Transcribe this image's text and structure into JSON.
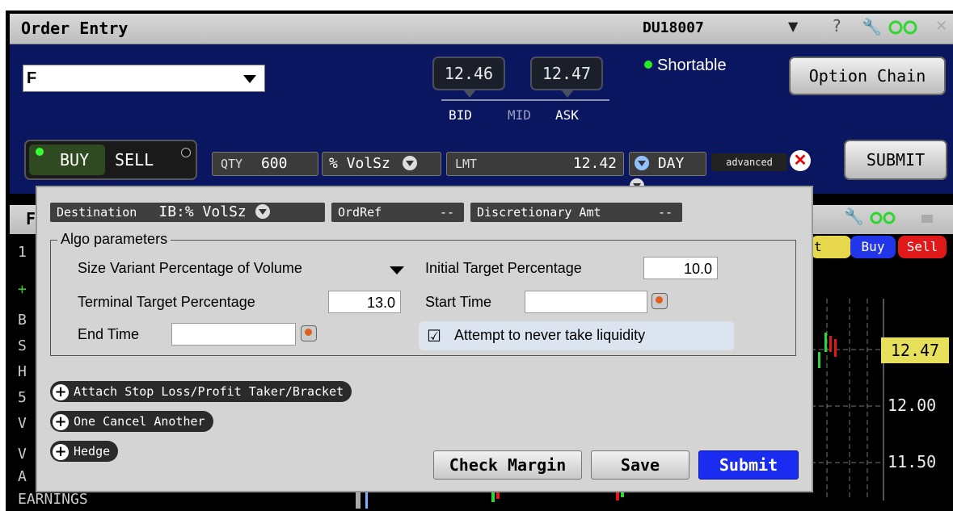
{
  "window": {
    "title": "Order Entry",
    "account": "DU18007",
    "help": "?"
  },
  "order": {
    "symbol": "F",
    "bid": "12.46",
    "ask": "12.47",
    "bid_label": "BID",
    "mid_label": "MID",
    "ask_label": "ASK",
    "shortable": "Shortable",
    "option_chain": "Option Chain",
    "buy": "BUY",
    "sell": "SELL",
    "qty_label": "QTY",
    "qty": "600",
    "order_type": "% VolSz",
    "lmt_label": "LMT",
    "lmt": "12.42",
    "tif": "DAY",
    "advanced": "advanced",
    "submit": "SUBMIT"
  },
  "background_window": {
    "title_initial": "F",
    "left_labels": [
      "1",
      "+",
      "B",
      "S",
      "H",
      "5",
      "V",
      "V",
      "A"
    ],
    "earnings": "EARNINGS",
    "t_btn": "t",
    "buy": "Buy",
    "sell": "Sell",
    "price_tag": "12.47",
    "prices": [
      "12.00",
      "11.50"
    ]
  },
  "advanced_panel": {
    "destination_label": "Destination",
    "destination_value": "IB:% VolSz",
    "ordref_label": "OrdRef",
    "ordref_value": "--",
    "disc_label": "Discretionary Amt",
    "disc_value": "--",
    "algo_legend": "Algo parameters",
    "algo_strategy": "Size Variant Percentage of Volume",
    "initial_target_label": "Initial Target Percentage",
    "initial_target_value": "10.0",
    "terminal_target_label": "Terminal Target Percentage",
    "terminal_target_value": "13.0",
    "start_time_label": "Start Time",
    "start_time_value": "",
    "end_time_label": "End Time",
    "end_time_value": "",
    "never_take_liquidity": "Attempt to never take liquidity",
    "never_take_liquidity_checked": true,
    "attach_stop": "Attach Stop Loss/Profit Taker/Bracket",
    "oca": "One Cancel Another",
    "hedge": "Hedge",
    "check_margin": "Check Margin",
    "save": "Save",
    "submit": "Submit"
  },
  "colors": {
    "navy": "#0b1660",
    "buy_green": "#33ff33",
    "submit_blue": "#1a2cf0",
    "sell_red": "#e01818",
    "price_tag": "#e6e05a"
  }
}
